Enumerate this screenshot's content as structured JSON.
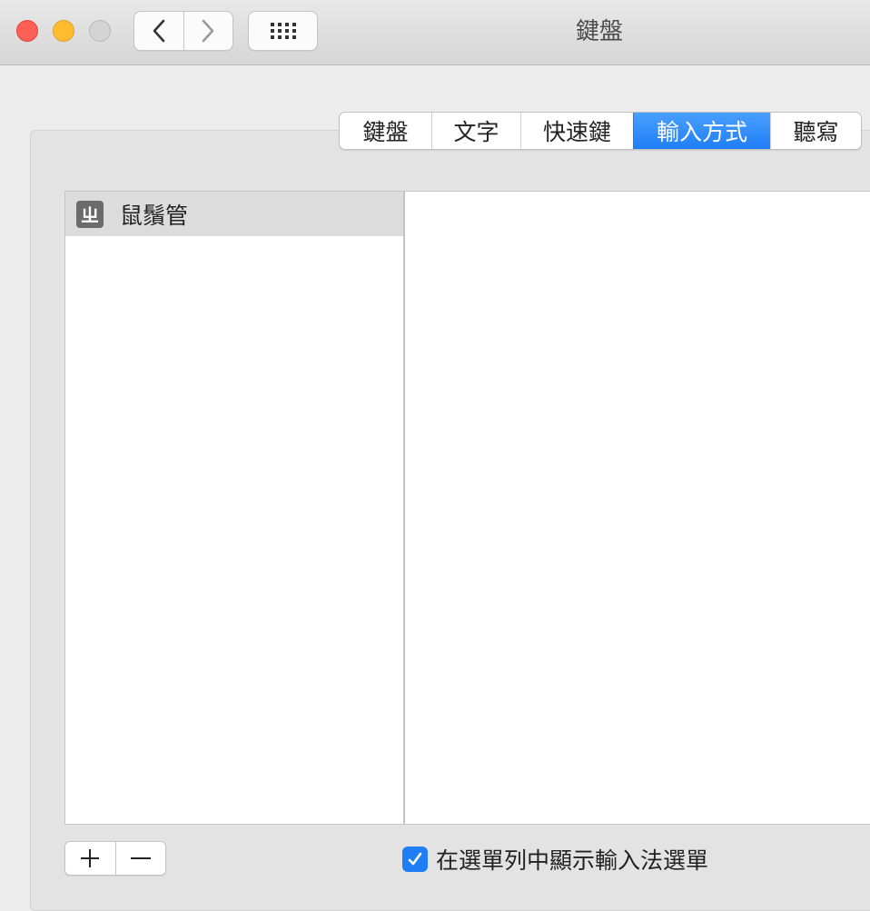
{
  "window": {
    "title": "鍵盤",
    "traffic_lights": {
      "close": "#fe5f57",
      "minimize": "#febc2e",
      "zoom": "#d4d4d4"
    },
    "icons": {
      "back": "chevron-left-icon",
      "forward": "chevron-right-icon",
      "show_all": "grid-icon"
    }
  },
  "tabs": [
    {
      "label": "鍵盤",
      "active": false
    },
    {
      "label": "文字",
      "active": false
    },
    {
      "label": "快速鍵",
      "active": false
    },
    {
      "label": "輸入方式",
      "active": true
    },
    {
      "label": "聽寫",
      "active": false
    }
  ],
  "input_sources": [
    {
      "icon_glyph": "ㄓ",
      "name": "鼠鬚管",
      "selected": true
    }
  ],
  "bottom": {
    "add_icon": "plus-icon",
    "remove_icon": "minus-icon",
    "show_menu_checkbox": {
      "label": "在選單列中顯示輸入法選單",
      "checked": true
    }
  },
  "colors": {
    "accent": "#1f7ef6"
  }
}
